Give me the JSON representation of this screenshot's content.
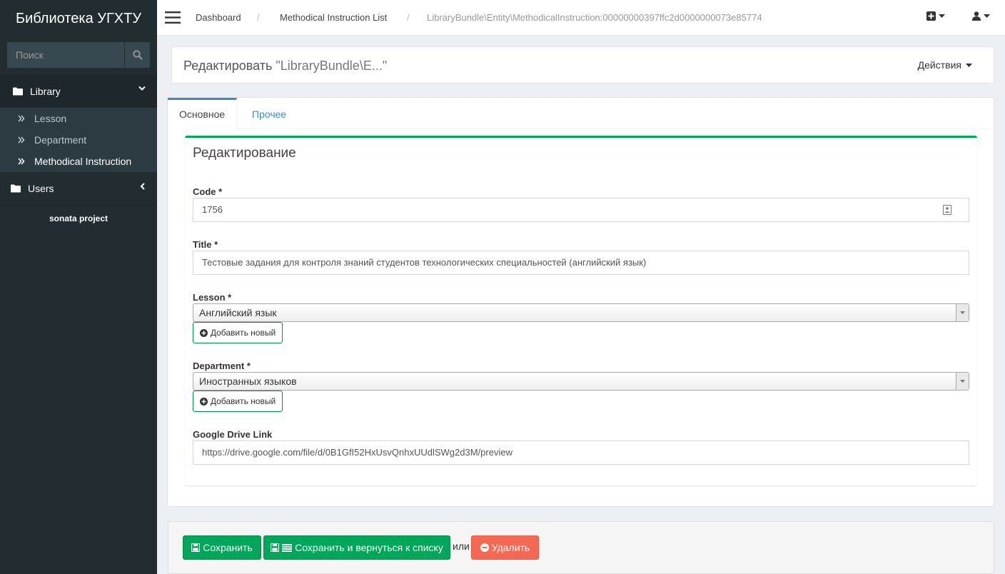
{
  "app": {
    "title": "Библиотека УГХТУ"
  },
  "search": {
    "placeholder": "Поиск"
  },
  "sidebar": {
    "sections": [
      {
        "label": "Library",
        "items": [
          {
            "label": "Lesson"
          },
          {
            "label": "Department"
          },
          {
            "label": "Methodical Instruction"
          }
        ]
      },
      {
        "label": "Users"
      }
    ],
    "footer": "sonata project"
  },
  "breadcrumb": {
    "items": [
      "Dashboard",
      "Methodical Instruction List",
      "LibraryBundle\\Entity\\MethodicalInstruction:00000000397ffc2d0000000073e85774"
    ],
    "separator": "/"
  },
  "page": {
    "title_prefix": "Редактировать",
    "title_object": "\"LibraryBundle\\E...\"",
    "actions_label": "Действия"
  },
  "tabs": [
    {
      "label": "Основное"
    },
    {
      "label": "Прочее"
    }
  ],
  "form": {
    "title": "Редактирование",
    "code": {
      "label": "Code *",
      "value": "1756"
    },
    "title_field": {
      "label": "Title *",
      "value": "Тестовые задания для контроля знаний студентов технологических специальностей (английский язык)"
    },
    "lesson": {
      "label": "Lesson *",
      "value": "Английский язык",
      "add_label": "Добавить новый"
    },
    "department": {
      "label": "Department *",
      "value": "Иностранных языков",
      "add_label": "Добавить новый"
    },
    "gdrive": {
      "label": "Google Drive Link",
      "value": "https://drive.google.com/file/d/0B1GfI52HxUsvQnhxUUdlSWg2d3M/preview"
    }
  },
  "footer": {
    "save_label": "Сохранить",
    "save_return_label": "Сохранить и вернуться к списку",
    "or_label": "или",
    "delete_label": "Удалить"
  },
  "colors": {
    "sidebar": "#222d32",
    "accent": "#3c8dbc",
    "success": "#00a65a",
    "danger": "#f56954"
  }
}
